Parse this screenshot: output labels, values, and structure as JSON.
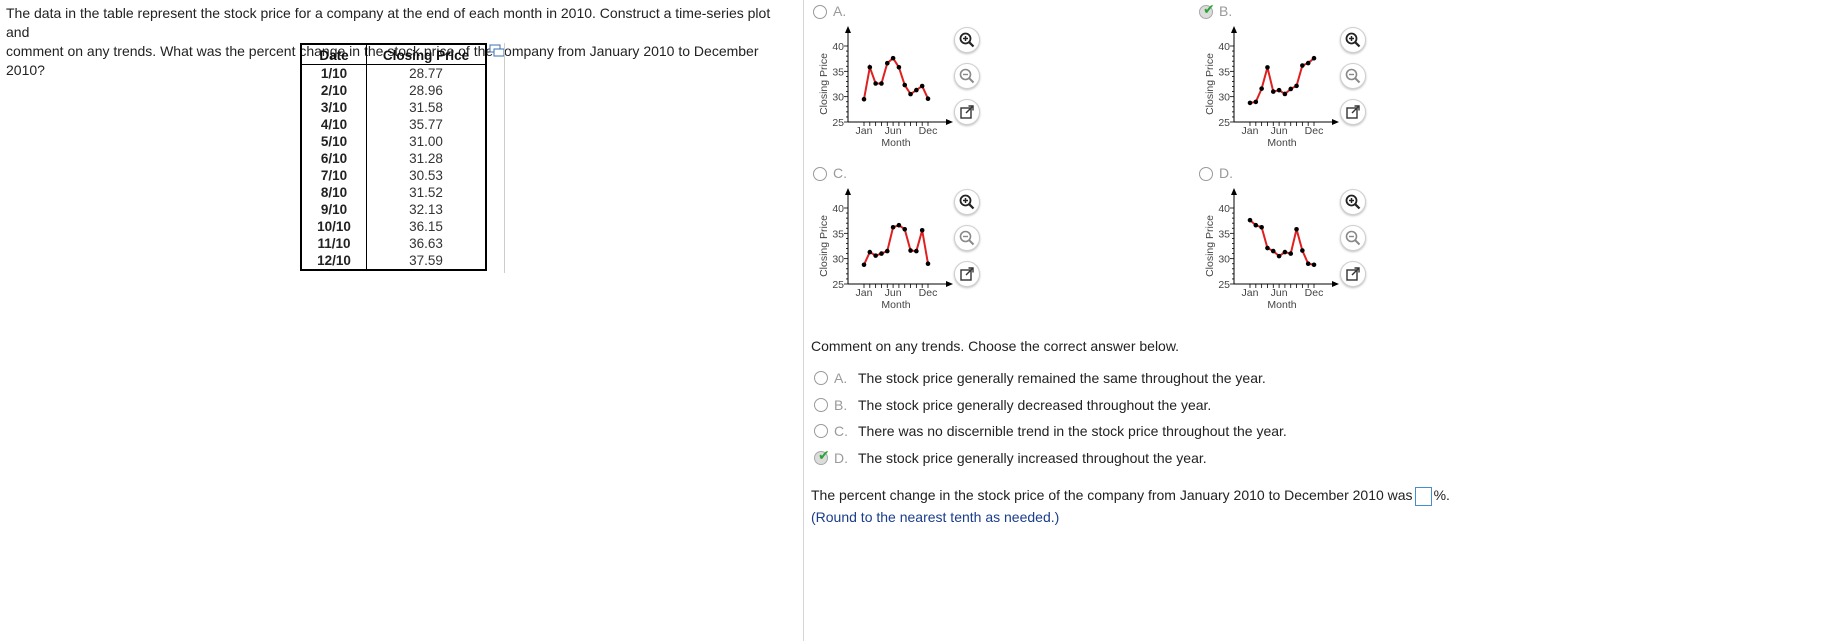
{
  "question": {
    "line1": "The data in the table represent the stock price for a company at the end of each month in 2010. Construct a time-series plot and",
    "line2": "comment on any trends. What was the percent change in the stock price of the company from January 2010 to December 2010?"
  },
  "table": {
    "headers": [
      "Date",
      "Closing Price"
    ],
    "rows": [
      [
        "1/10",
        "28.77"
      ],
      [
        "2/10",
        "28.96"
      ],
      [
        "3/10",
        "31.58"
      ],
      [
        "4/10",
        "35.77"
      ],
      [
        "5/10",
        "31.00"
      ],
      [
        "6/10",
        "31.28"
      ],
      [
        "7/10",
        "30.53"
      ],
      [
        "8/10",
        "31.52"
      ],
      [
        "9/10",
        "32.13"
      ],
      [
        "10/10",
        "36.15"
      ],
      [
        "11/10",
        "36.63"
      ],
      [
        "12/10",
        "37.59"
      ]
    ]
  },
  "graph_options": {
    "A": {
      "letter": "A.",
      "selected": false
    },
    "B": {
      "letter": "B.",
      "selected": true
    },
    "C": {
      "letter": "C.",
      "selected": false
    },
    "D": {
      "letter": "D.",
      "selected": false
    }
  },
  "chart_data": [
    {
      "type": "line",
      "option": "A",
      "x": [
        "Jan",
        "Feb",
        "Mar",
        "Apr",
        "May",
        "Jun",
        "Jul",
        "Aug",
        "Sep",
        "Oct",
        "Nov",
        "Dec"
      ],
      "values": [
        29.5,
        35.8,
        32.6,
        32.6,
        36.6,
        37.6,
        35.8,
        32.3,
        30.5,
        31.3,
        32.1,
        29.6
      ],
      "xlabel": "Month",
      "ylabel": "Closing Price",
      "ylim": [
        25,
        40
      ],
      "yticks": [
        "25",
        "30",
        "35",
        "40"
      ],
      "xticks": [
        "Jan",
        "Jun",
        "Dec"
      ],
      "line_color": "#e02020",
      "marker_color": "#000000"
    },
    {
      "type": "line",
      "option": "B",
      "x": [
        "Jan",
        "Feb",
        "Mar",
        "Apr",
        "May",
        "Jun",
        "Jul",
        "Aug",
        "Sep",
        "Oct",
        "Nov",
        "Dec"
      ],
      "values": [
        28.77,
        28.96,
        31.58,
        35.77,
        31.0,
        31.28,
        30.53,
        31.52,
        32.13,
        36.15,
        36.63,
        37.59
      ],
      "xlabel": "Month",
      "ylabel": "Closing Price",
      "ylim": [
        25,
        40
      ],
      "yticks": [
        "25",
        "30",
        "35",
        "40"
      ],
      "xticks": [
        "Jan",
        "Jun",
        "Dec"
      ],
      "line_color": "#e02020",
      "marker_color": "#000000"
    },
    {
      "type": "line",
      "option": "C",
      "x": [
        "Jan",
        "Feb",
        "Mar",
        "Apr",
        "May",
        "Jun",
        "Jul",
        "Aug",
        "Sep",
        "Oct",
        "Nov",
        "Dec"
      ],
      "values": [
        28.8,
        31.3,
        30.6,
        31.0,
        31.5,
        36.2,
        36.6,
        35.8,
        31.6,
        31.5,
        35.6,
        29.0
      ],
      "xlabel": "Month",
      "ylabel": "Closing Price",
      "ylim": [
        25,
        40
      ],
      "yticks": [
        "25",
        "30",
        "35",
        "40"
      ],
      "xticks": [
        "Jan",
        "Jun",
        "Dec"
      ],
      "line_color": "#e02020",
      "marker_color": "#000000"
    },
    {
      "type": "line",
      "option": "D",
      "x": [
        "Jan",
        "Feb",
        "Mar",
        "Apr",
        "May",
        "Jun",
        "Jul",
        "Aug",
        "Sep",
        "Oct",
        "Nov",
        "Dec"
      ],
      "values": [
        37.6,
        36.6,
        36.2,
        32.1,
        31.5,
        30.5,
        31.3,
        31.0,
        35.8,
        31.6,
        29.0,
        28.8
      ],
      "xlabel": "Month",
      "ylabel": "Closing Price",
      "ylim": [
        25,
        40
      ],
      "yticks": [
        "25",
        "30",
        "35",
        "40"
      ],
      "xticks": [
        "Jan",
        "Jun",
        "Dec"
      ],
      "line_color": "#e02020",
      "marker_color": "#000000"
    }
  ],
  "tools": [
    "zoom-in-icon",
    "zoom-out-icon",
    "popout-icon"
  ],
  "comment": {
    "prompt": "Comment on any trends. Choose the correct answer below.",
    "options": [
      {
        "letter": "A.",
        "text": "The stock price generally remained the same throughout the year.",
        "selected": false
      },
      {
        "letter": "B.",
        "text": "The stock price generally decreased throughout the year.",
        "selected": false
      },
      {
        "letter": "C.",
        "text": "There was no discernible trend in the stock price throughout the year.",
        "selected": false
      },
      {
        "letter": "D.",
        "text": "The stock price generally increased throughout the year.",
        "selected": true
      }
    ]
  },
  "percent": {
    "before": "The percent change in the stock price of the company from January 2010 to December 2010 was",
    "after": "%.",
    "value": "",
    "hint": "(Round to the nearest tenth as needed.)"
  },
  "colors": {
    "check": "#2aa53a",
    "hint": "#1a3c8c",
    "input_border": "#4a8cc8",
    "line": "#e02020"
  }
}
